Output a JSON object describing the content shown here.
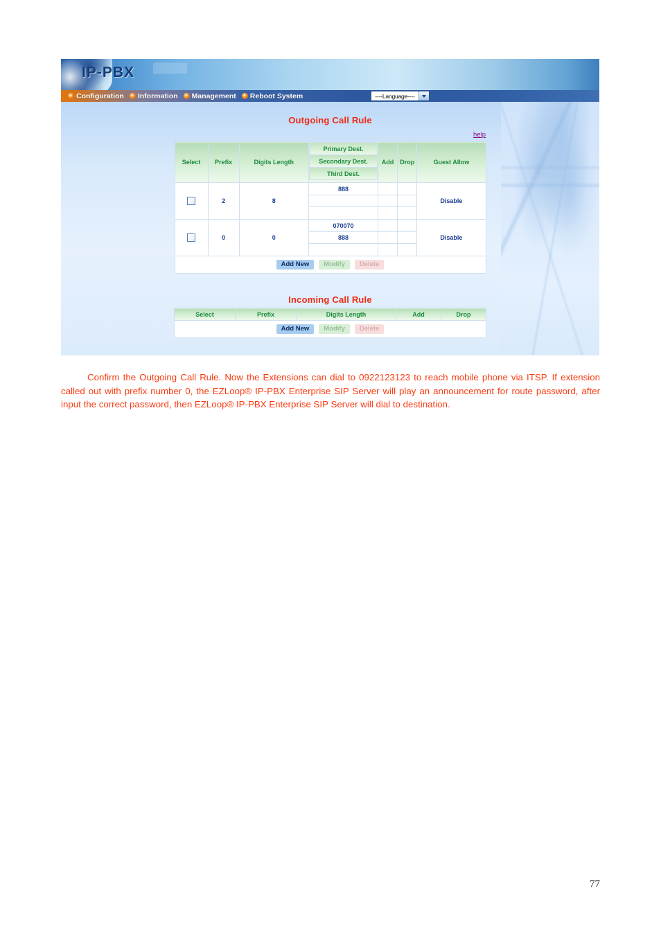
{
  "app": {
    "logo_text": "IP-PBX",
    "nav_items": [
      {
        "label": "Configuration",
        "icon": "bullet-arrow-icon"
      },
      {
        "label": "Information",
        "icon": "bullet-arrow-icon"
      },
      {
        "label": "Management",
        "icon": "bullet-arrow-icon"
      },
      {
        "label": "Reboot System",
        "icon": "bullet-arrow-icon"
      }
    ],
    "language_select": {
      "selected": "----Language----",
      "icon": "chevron-down-icon"
    },
    "outgoing": {
      "title": "Outgoing Call Rule",
      "help_label": "help",
      "headers": {
        "select": "Select",
        "prefix": "Prefix",
        "digits_length": "Digits Length",
        "primary_dest": "Primary Dest.",
        "secondary_dest": "Secondary Dest.",
        "third_dest": "Third Dest.",
        "add": "Add",
        "drop": "Drop",
        "guest_allow": "Guest Allow"
      },
      "rows": [
        {
          "selected": false,
          "prefix": "2",
          "digits_length": "8",
          "primary_dest": "888",
          "secondary_dest": "",
          "third_dest": "",
          "add": "",
          "drop": "",
          "guest_allow": "Disable"
        },
        {
          "selected": false,
          "prefix": "0",
          "digits_length": "0",
          "primary_dest": "070070",
          "secondary_dest": "888",
          "third_dest": "",
          "add": "",
          "drop": "",
          "guest_allow": "Disable"
        }
      ],
      "buttons": {
        "add_new": "Add New",
        "modify": "Modify",
        "delete": "Delete"
      }
    },
    "incoming": {
      "title": "Incoming Call Rule",
      "headers": {
        "select": "Select",
        "prefix": "Prefix",
        "digits_length": "Digits Length",
        "add": "Add",
        "drop": "Drop"
      },
      "rows": [],
      "buttons": {
        "add_new": "Add New",
        "modify": "Modify",
        "delete": "Delete"
      }
    }
  },
  "document": {
    "paragraph": "Confirm the Outgoing Call Rule. Now the Extensions can dial to 0922123123 to reach mobile phone via ITSP. If extension called out with prefix number 0, the EZLoop® IP-PBX Enterprise SIP Server will play an announcement for route password, after input the correct password, then EZLoop® IP-PBX Enterprise SIP Server will dial to destination.",
    "page_number": "77"
  },
  "colors": {
    "title_red": "#ef2a14",
    "header_green": "#1c8a3c",
    "data_blue": "#1b3f93",
    "help_purple": "#8a0f8a",
    "body_text": "#fb3a10",
    "nav_orange": "#e2750e",
    "nav_blue": "#2d589f"
  }
}
